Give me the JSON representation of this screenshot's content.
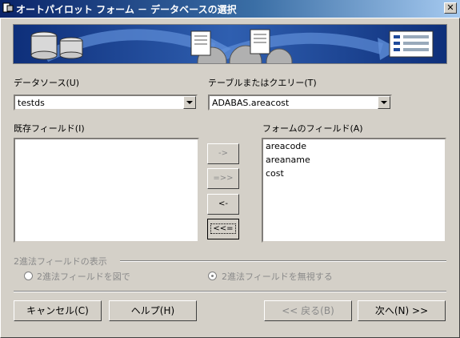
{
  "window": {
    "title": "オートパイロット フォーム － データベースの選択",
    "close_glyph": "✕"
  },
  "datasource": {
    "label": "データソース(U)",
    "value": "testds"
  },
  "table": {
    "label": "テーブルまたはクエリー(T)",
    "value": "ADABAS.areacost"
  },
  "existing_fields": {
    "label": "既存フィールド(I)",
    "items": []
  },
  "form_fields": {
    "label": "フォームのフィールド(A)",
    "items": [
      "areacode",
      "areaname",
      "cost"
    ]
  },
  "move_buttons": {
    "add_one": "->",
    "add_all": "=>>",
    "remove_one": "<-",
    "remove_all": "<<="
  },
  "binary_fields": {
    "group_label": "2進法フィールドの表示",
    "option_image": "2進法フィールドを図で",
    "option_ignore": "2進法フィールドを無視する",
    "selected": "option_ignore"
  },
  "footer": {
    "cancel": "キャンセル(C)",
    "help": "ヘルプ(H)",
    "back": "<< 戻る(B)",
    "next": "次へ(N) >>"
  },
  "colors": {
    "title_start": "#0a246a",
    "title_end": "#a6caf0",
    "banner": "#1f4a9a",
    "face": "#d4d0c8"
  }
}
